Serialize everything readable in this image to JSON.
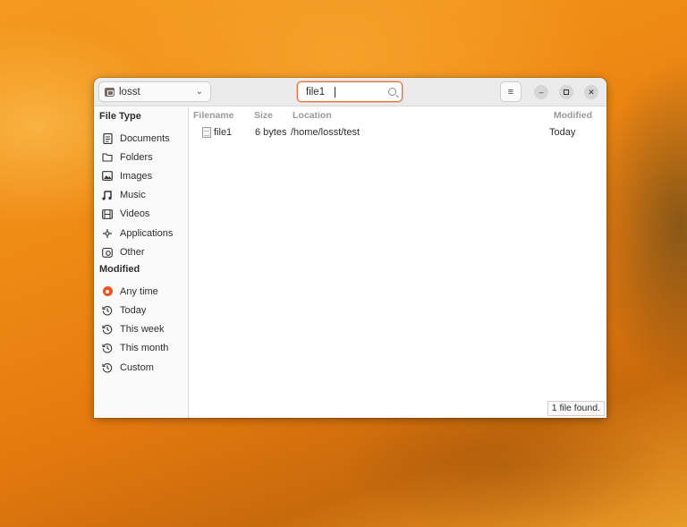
{
  "header": {
    "location": "losst",
    "search_value": "file1",
    "menu_icon": "hamburger-icon"
  },
  "sidebar": {
    "file_type_title": "File Type",
    "file_types": [
      {
        "label": "Documents",
        "icon": "document-icon"
      },
      {
        "label": "Folders",
        "icon": "folder-icon"
      },
      {
        "label": "Images",
        "icon": "image-icon"
      },
      {
        "label": "Music",
        "icon": "music-icon"
      },
      {
        "label": "Videos",
        "icon": "video-icon"
      },
      {
        "label": "Applications",
        "icon": "applications-icon"
      },
      {
        "label": "Other",
        "icon": "other-icon"
      }
    ],
    "modified_title": "Modified",
    "modified": [
      {
        "label": "Any time",
        "icon": "radio-selected-icon",
        "selected": true
      },
      {
        "label": "Today",
        "icon": "history-icon"
      },
      {
        "label": "This week",
        "icon": "history-icon"
      },
      {
        "label": "This month",
        "icon": "history-icon"
      },
      {
        "label": "Custom",
        "icon": "history-icon"
      }
    ]
  },
  "results": {
    "columns": {
      "filename": "Filename",
      "size": "Size",
      "location": "Location",
      "modified": "Modified"
    },
    "rows": [
      {
        "filename": "file1",
        "size": "6 bytes",
        "location": "/home/losst/test",
        "modified": "Today"
      }
    ],
    "status": "1 file found."
  },
  "colors": {
    "accent": "#e95420",
    "search_border": "#e0713a"
  }
}
